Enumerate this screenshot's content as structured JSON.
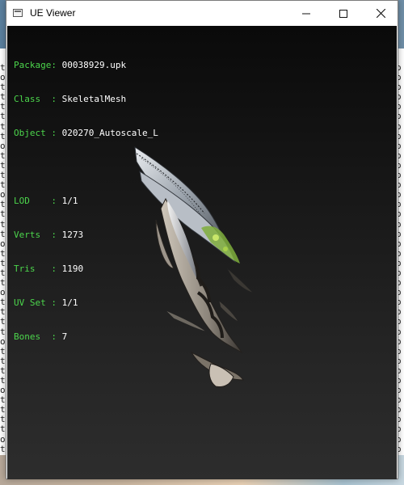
{
  "window": {
    "title": "UE Viewer"
  },
  "controls": {
    "minimize_icon": "minimize-icon",
    "maximize_icon": "maximize-icon",
    "close_icon": "close-icon"
  },
  "info": {
    "package": {
      "key": "Package: ",
      "value": "00038929.upk"
    },
    "class": {
      "key": "Class  : ",
      "value": "SkeletalMesh"
    },
    "object": {
      "key": "Object : ",
      "value": "020270_Autoscale_L"
    },
    "lod": {
      "key": "LOD    : ",
      "value": "1/1"
    },
    "verts": {
      "key": "Verts  : ",
      "value": "1273"
    },
    "tris": {
      "key": "Tris   : ",
      "value": "1190"
    },
    "uvset": {
      "key": "UV Set : ",
      "value": "1/1"
    },
    "bones": {
      "key": "Bones  : ",
      "value": "7"
    }
  },
  "colors": {
    "label_green": "#4cd64c",
    "value_white": "#ffffff",
    "viewport_bg": "#1a1a1a"
  }
}
